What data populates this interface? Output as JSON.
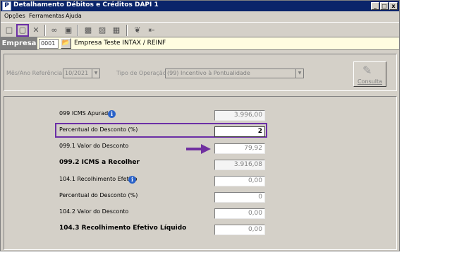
{
  "window": {
    "title": "Detalhamento Débitos e Créditos DAPI 1",
    "app_icon": "P",
    "controls": {
      "minimize": "_",
      "maximize": "□",
      "close": "x"
    }
  },
  "menu": [
    "Opções",
    "Ferramentas",
    "Ajuda"
  ],
  "toolbar_icons": [
    "new-doc-icon",
    "open-doc-icon",
    "delete-icon",
    "link-icon",
    "save-icon",
    "report-icon",
    "print-icon",
    "export-icon",
    "tools-icon",
    "exit-icon"
  ],
  "empresa": {
    "label": "Empresa",
    "code": "0001",
    "name": "Empresa Teste INTAX / REINF"
  },
  "filters": {
    "mes_ano_label": "Mês/Ano Referência",
    "mes_ano_value": "10/2021",
    "tipo_label": "Tipo de Operação",
    "tipo_value": "(99) Incentivo à Pontualidade",
    "consulta_label": "Consulta"
  },
  "rows": [
    {
      "label": "099 ICMS Apurado",
      "value": "3.996,00",
      "info": true
    },
    {
      "label": "Percentual do Desconto (%)",
      "value": "2",
      "highlighted": true
    },
    {
      "label": "099.1 Valor do Desconto",
      "value": "79,92",
      "arrow": true
    },
    {
      "label": "099.2 ICMS  a Recolher",
      "value": "3.916,08",
      "bold": true
    },
    {
      "label": "104.1 Recolhimento Efetivo",
      "value": "0,00",
      "info": true
    },
    {
      "label": "Percentual do Desconto (%)",
      "value": "0"
    },
    {
      "label": "104.2 Valor do Desconto",
      "value": "0,00"
    },
    {
      "label": "104.3 Recolhimento Efetivo Líquido",
      "value": "0,00",
      "bold": true
    }
  ],
  "colors": {
    "titlebar": "#0a246a",
    "highlight": "#6b2fa6",
    "arrow": "#7030a0",
    "empresa_bg": "#fffde0"
  }
}
